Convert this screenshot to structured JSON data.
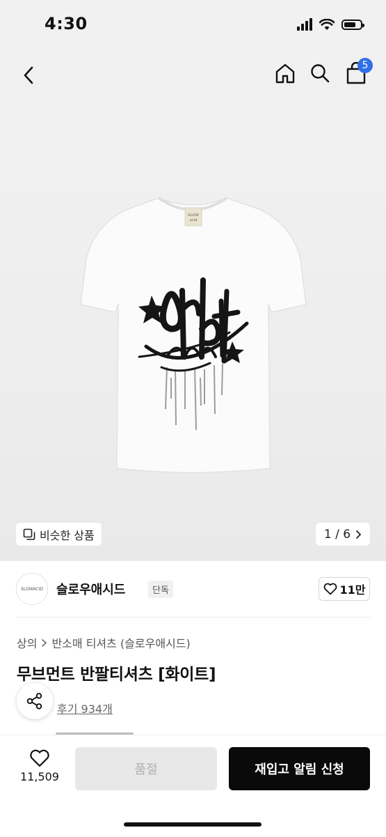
{
  "status_bar": {
    "time": "4:30"
  },
  "header": {
    "cart_count": "5"
  },
  "gallery": {
    "similar_label": "비슷한 상품",
    "page_indicator": "1 / 6",
    "shirt_tag_text": "SLOW acid",
    "print_text": "Orbit SLOWACID"
  },
  "brand": {
    "logo_text": "SLOWACID",
    "name": "슬로우애시드",
    "exclusive_badge": "단독",
    "like_count": "11만"
  },
  "product": {
    "breadcrumb": [
      "상의",
      "반소매 티셔츠 (슬로우애시드)"
    ],
    "title": "무브먼트 반팔티셔츠 [화이트]",
    "review_link": "후기 934개"
  },
  "bottom": {
    "wish_count": "11,509",
    "soldout_label": "품절",
    "restock_label": "재입고 알림 신청"
  }
}
